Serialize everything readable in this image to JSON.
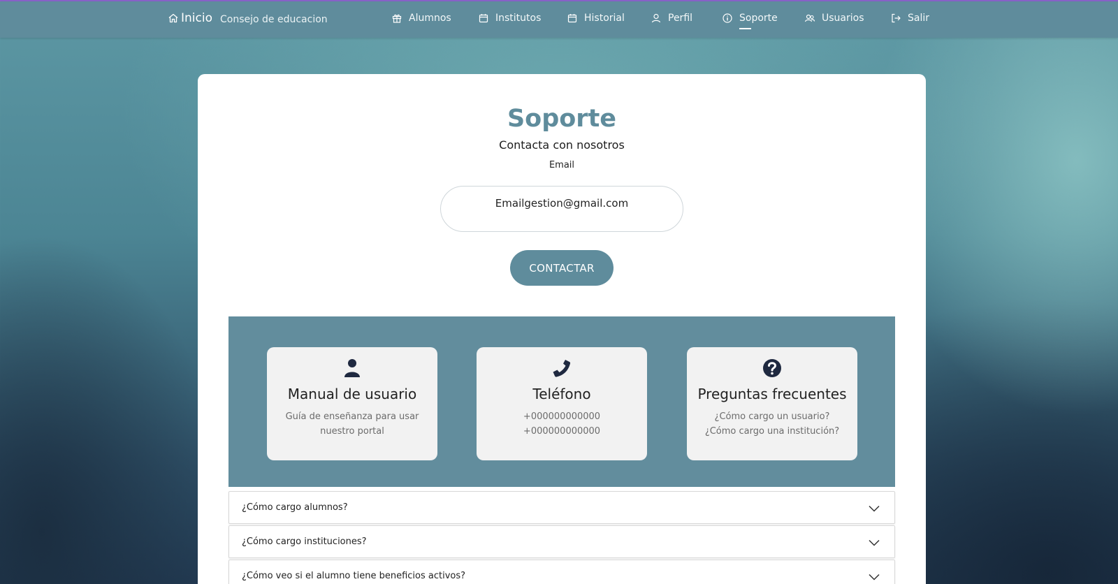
{
  "nav": {
    "brand_title": "Inicio",
    "brand_subtitle": "Consejo de educacion",
    "items": [
      {
        "label": "Alumnos",
        "icon": "gift-icon"
      },
      {
        "label": "Institutos",
        "icon": "calendar-icon"
      },
      {
        "label": "Historial",
        "icon": "calendar-icon"
      },
      {
        "label": "Perfil",
        "icon": "user-icon"
      },
      {
        "label": "Soporte",
        "icon": "info-circle-icon",
        "active": true
      },
      {
        "label": "Usuarios",
        "icon": "users-icon"
      },
      {
        "label": "Salir",
        "icon": "logout-icon"
      }
    ]
  },
  "main": {
    "title": "Soporte",
    "subtitle": "Contacta con nosotros",
    "email_label": "Email",
    "email_value": "Emailgestion@gmail.com",
    "contact_button": "CONTACTAR"
  },
  "info_cards": [
    {
      "icon": "user-icon",
      "title": "Manual de usuario",
      "line1": "Guía de enseñanza para usar",
      "line2": "nuestro portal"
    },
    {
      "icon": "phone-icon",
      "title": "Teléfono",
      "line1": "+000000000000",
      "line2": "+000000000000"
    },
    {
      "icon": "question-circle-icon",
      "title": "Preguntas frecuentes",
      "line1": "¿Cómo cargo un usuario?",
      "line2": "¿Cómo cargo una institución?"
    }
  ],
  "faq": [
    {
      "question": "¿Cómo cargo alumnos?"
    },
    {
      "question": "¿Cómo cargo instituciones?"
    },
    {
      "question": "¿Cómo veo si el alumno tiene beneficios activos?"
    }
  ],
  "colors": {
    "accent": "#5f8c9c",
    "navbar": "#5f8c9c",
    "info_band": "#628d9d",
    "top_line": "#8a63c9",
    "card_bg": "#f2f2f2"
  }
}
